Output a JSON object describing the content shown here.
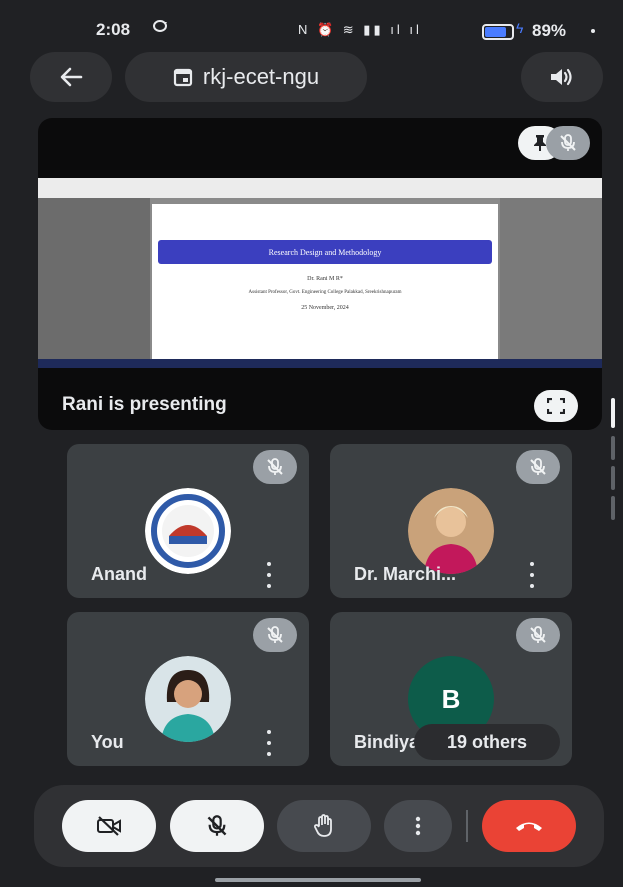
{
  "status_bar": {
    "time": "2:08",
    "system_icons": "N ⏰ ≋ ▮▮ ıl ıl",
    "battery_percent": "89%",
    "battery_level": 0.89
  },
  "header": {
    "meeting_code": "rkj-ecet-ngu"
  },
  "presentation": {
    "slide_title": "Research Design and Methodology",
    "slide_author": "Dr. Rani M R*",
    "slide_affiliation": "Assistant Professor, Govt. Engineering College Palakkad, Sreekrishnapuram",
    "slide_date": "25 November, 2024",
    "presenter_label": "Rani is presenting"
  },
  "participants": [
    {
      "name": "Anand"
    },
    {
      "name": "Dr. Marchi..."
    },
    {
      "name": "You"
    },
    {
      "name": "Bindiya",
      "initial": "B"
    }
  ],
  "others_chip": "19 others",
  "colors": {
    "background": "#202124",
    "tile": "#3c4043",
    "end_call": "#ea4335",
    "slide_title_bar": "#3b3fbf",
    "avatar_b": "#0d5c4a"
  }
}
